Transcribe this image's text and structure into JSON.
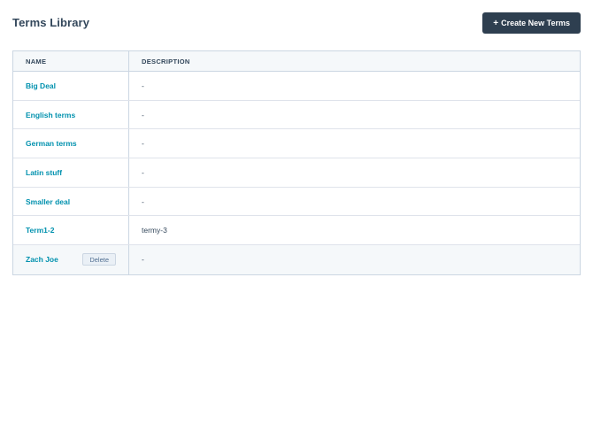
{
  "header": {
    "title": "Terms Library",
    "create_button": {
      "plus": "+",
      "label": "Create New Terms"
    }
  },
  "table": {
    "columns": {
      "name": "NAME",
      "description": "DESCRIPTION"
    },
    "rows": [
      {
        "name": "Big Deal",
        "description": "-"
      },
      {
        "name": "English terms",
        "description": "-"
      },
      {
        "name": "German terms",
        "description": "-"
      },
      {
        "name": "Latin stuff",
        "description": "-"
      },
      {
        "name": "Smaller deal",
        "description": "-"
      },
      {
        "name": "Term1-2",
        "description": "termy-3"
      },
      {
        "name": "Zach Joe",
        "description": "-",
        "delete_label": "Delete"
      }
    ]
  },
  "colors": {
    "accent_link": "#0091ae",
    "button_dark": "#2e3f50",
    "text": "#33475b",
    "border": "#cbd6e2"
  }
}
